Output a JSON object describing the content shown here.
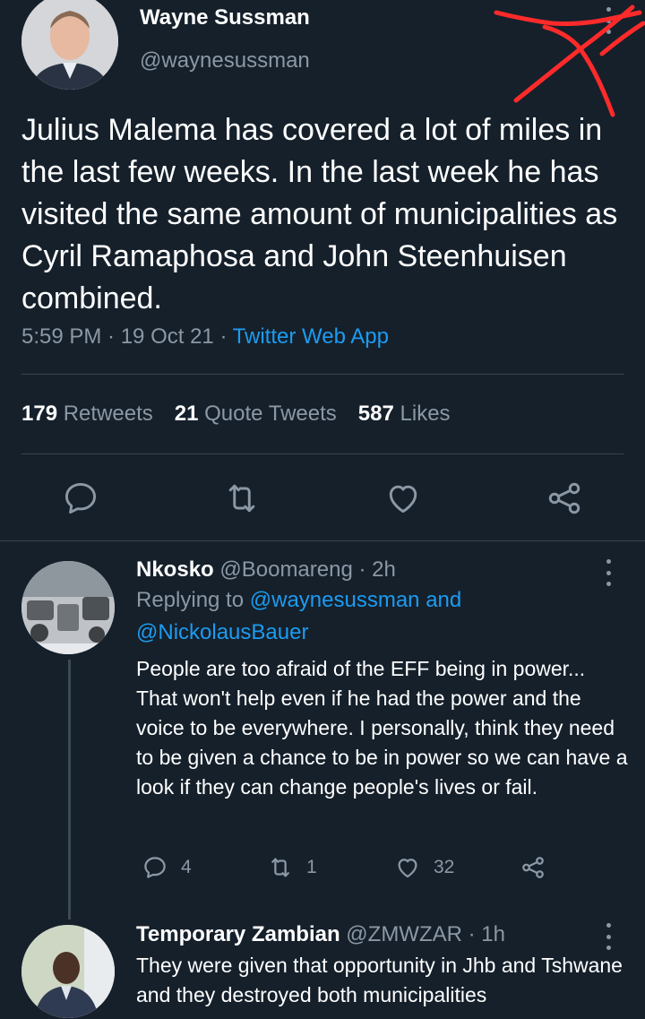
{
  "tweet": {
    "author": {
      "name": "Wayne Sussman",
      "handle": "@waynesussman"
    },
    "text": "Julius Malema has covered a lot of miles in the last few weeks. In the last week he has visited the same amount of municipalities as Cyril Ramaphosa and John Steenhuisen combined.",
    "time": "5:59 PM · 19 Oct 21 · ",
    "source": "Twitter Web App",
    "stats": {
      "retweets_count": "179",
      "retweets_label": "Retweets",
      "quotes_count": "21",
      "quotes_label": "Quote Tweets",
      "likes_count": "587",
      "likes_label": "Likes"
    },
    "actions": [
      "reply-icon",
      "retweet-icon",
      "like-icon",
      "share-icon"
    ]
  },
  "replies": [
    {
      "name": "Nkosko",
      "handle_time": " @Boomareng · 2h",
      "replying_prefix": "Replying to ",
      "replying_to_1": "@waynesussman and",
      "replying_to_2": "@NickolausBauer",
      "text": "People are too afraid of the EFF being in power... That won't help even if he had the power and the voice to be everywhere. I personally, think they need to be given a chance to be in power so we can have a look if they can change people's lives or fail.",
      "reply_count": "4",
      "retweet_count": "1",
      "like_count": "32"
    },
    {
      "name": "Temporary Zambian",
      "handle_time": " @ZMWZAR · 1h",
      "text": "They were given that opportunity in Jhb and Tshwane and they destroyed both municipalities"
    }
  ],
  "colors": {
    "background": "#15202b",
    "primary_text": "#ffffff",
    "secondary_text": "#8b98a5",
    "link": "#1d9bf0",
    "divider": "#38444d",
    "annotation": "#ff2a2a"
  }
}
